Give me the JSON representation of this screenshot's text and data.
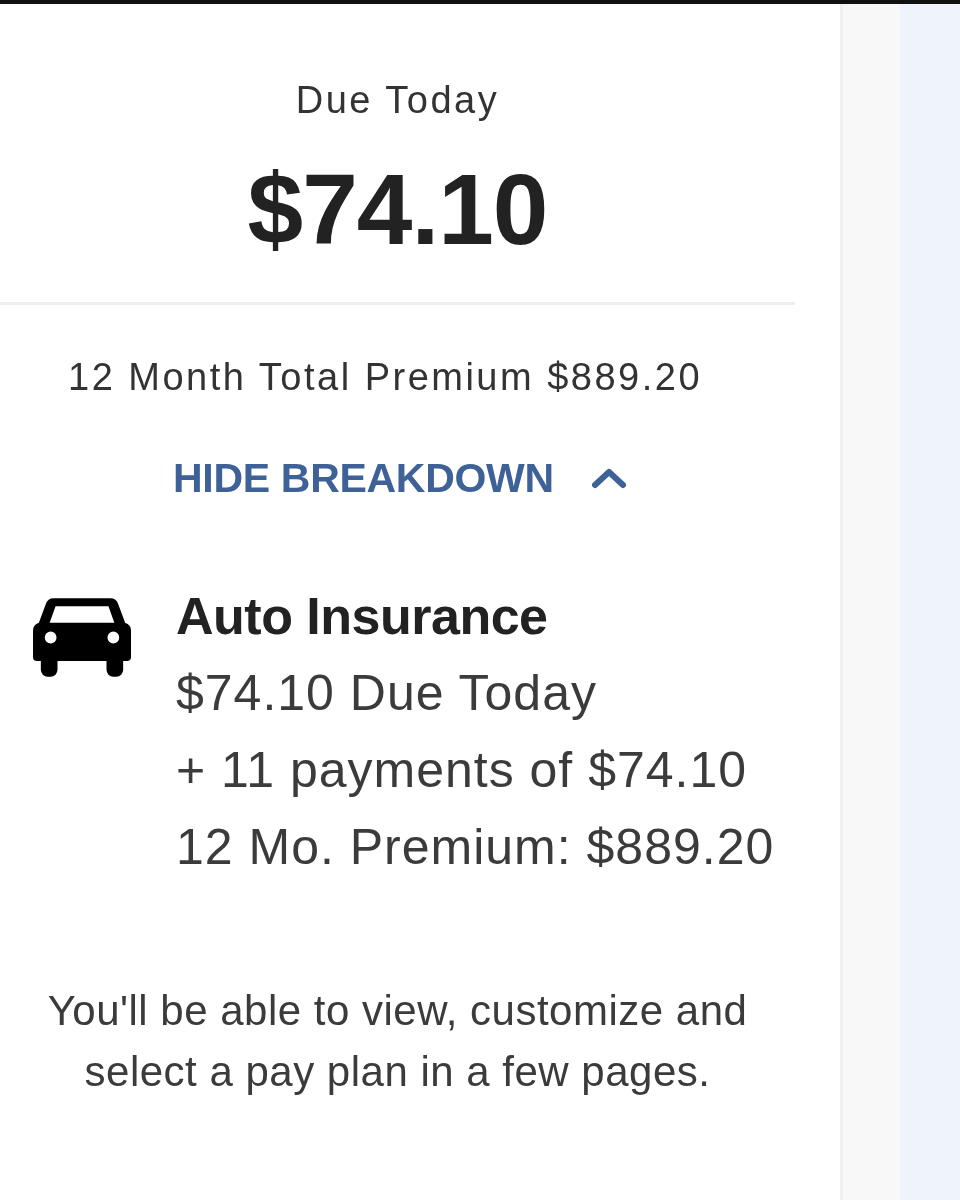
{
  "due_today": {
    "label": "Due Today",
    "amount": "$74.10"
  },
  "total_premium": "12 Month Total Premium $889.20",
  "breakdown_toggle": {
    "label": "HIDE BREAKDOWN",
    "expanded": true
  },
  "breakdown": [
    {
      "kind": "auto",
      "title": "Auto Insurance",
      "lines": [
        "$74.10 Due Today",
        "+ 11 payments of $74.10",
        "12 Mo. Premium: $889.20"
      ]
    }
  ],
  "note": "You'll be able to view, customize and select a pay plan in a few pages."
}
